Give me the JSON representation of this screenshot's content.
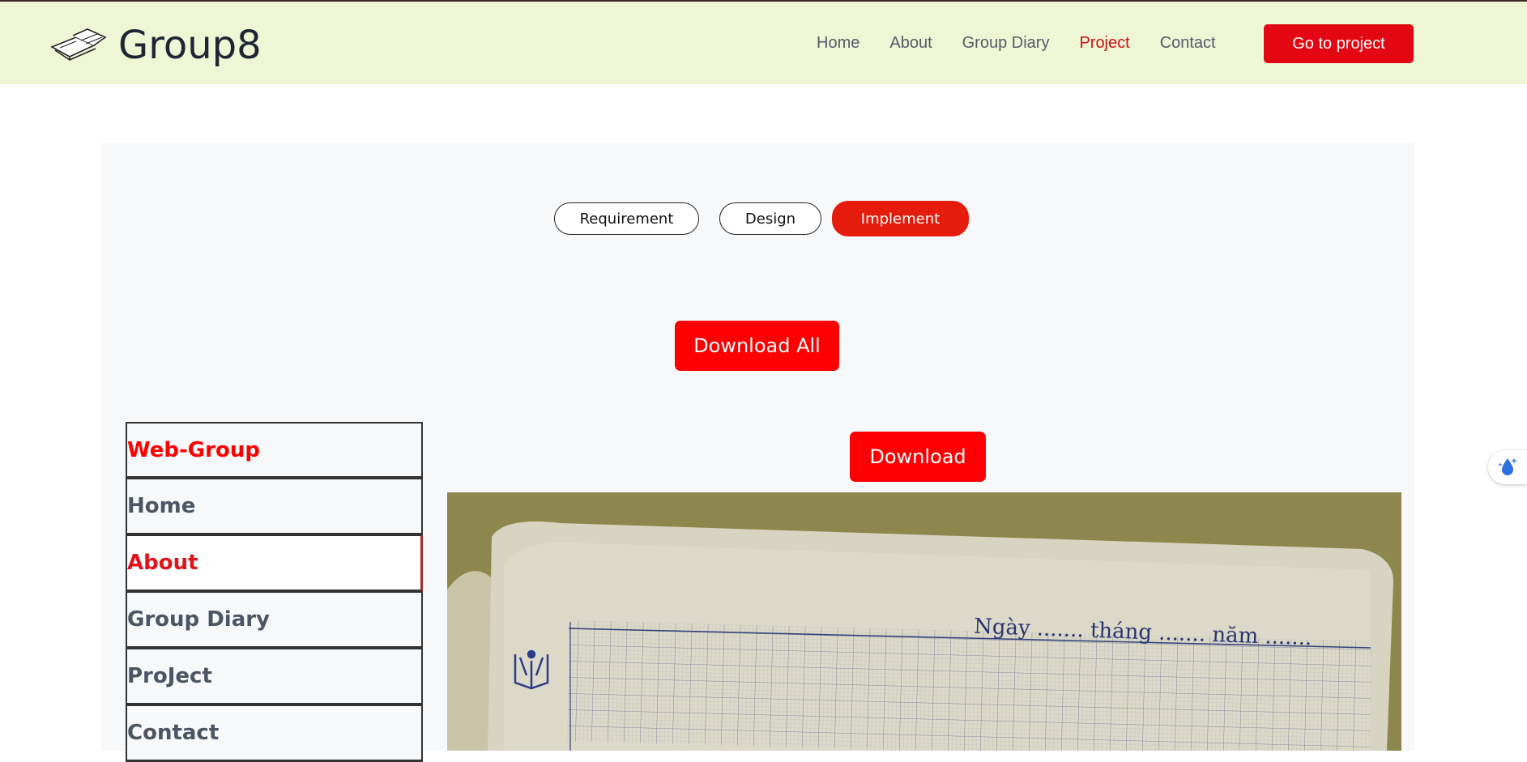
{
  "header": {
    "logo_text": "Group8",
    "nav": [
      "Home",
      "About",
      "Group Diary",
      "Project",
      "Contact"
    ],
    "active_nav": "Project",
    "cta_label": "Go to project"
  },
  "tabs": {
    "requirement": "Requirement",
    "design": "Design",
    "implement": "Implement",
    "active": "Implement"
  },
  "download_all_label": "Download All",
  "download_label": "Download",
  "sidemenu": {
    "title": "Web-Group",
    "items": [
      "Home",
      "About",
      "Group Diary",
      "ProJect",
      "Contact"
    ],
    "selected": "About"
  },
  "photo": {
    "caption": "Ngày ....... tháng ....... năm ......."
  },
  "colors": {
    "header_bg": "#eff6d6",
    "accent_red": "#e30613",
    "panel_bg": "#f7f8fa"
  },
  "icons": {
    "logo": "open-book-icon",
    "floater": "water-drop-sparkle-icon"
  }
}
